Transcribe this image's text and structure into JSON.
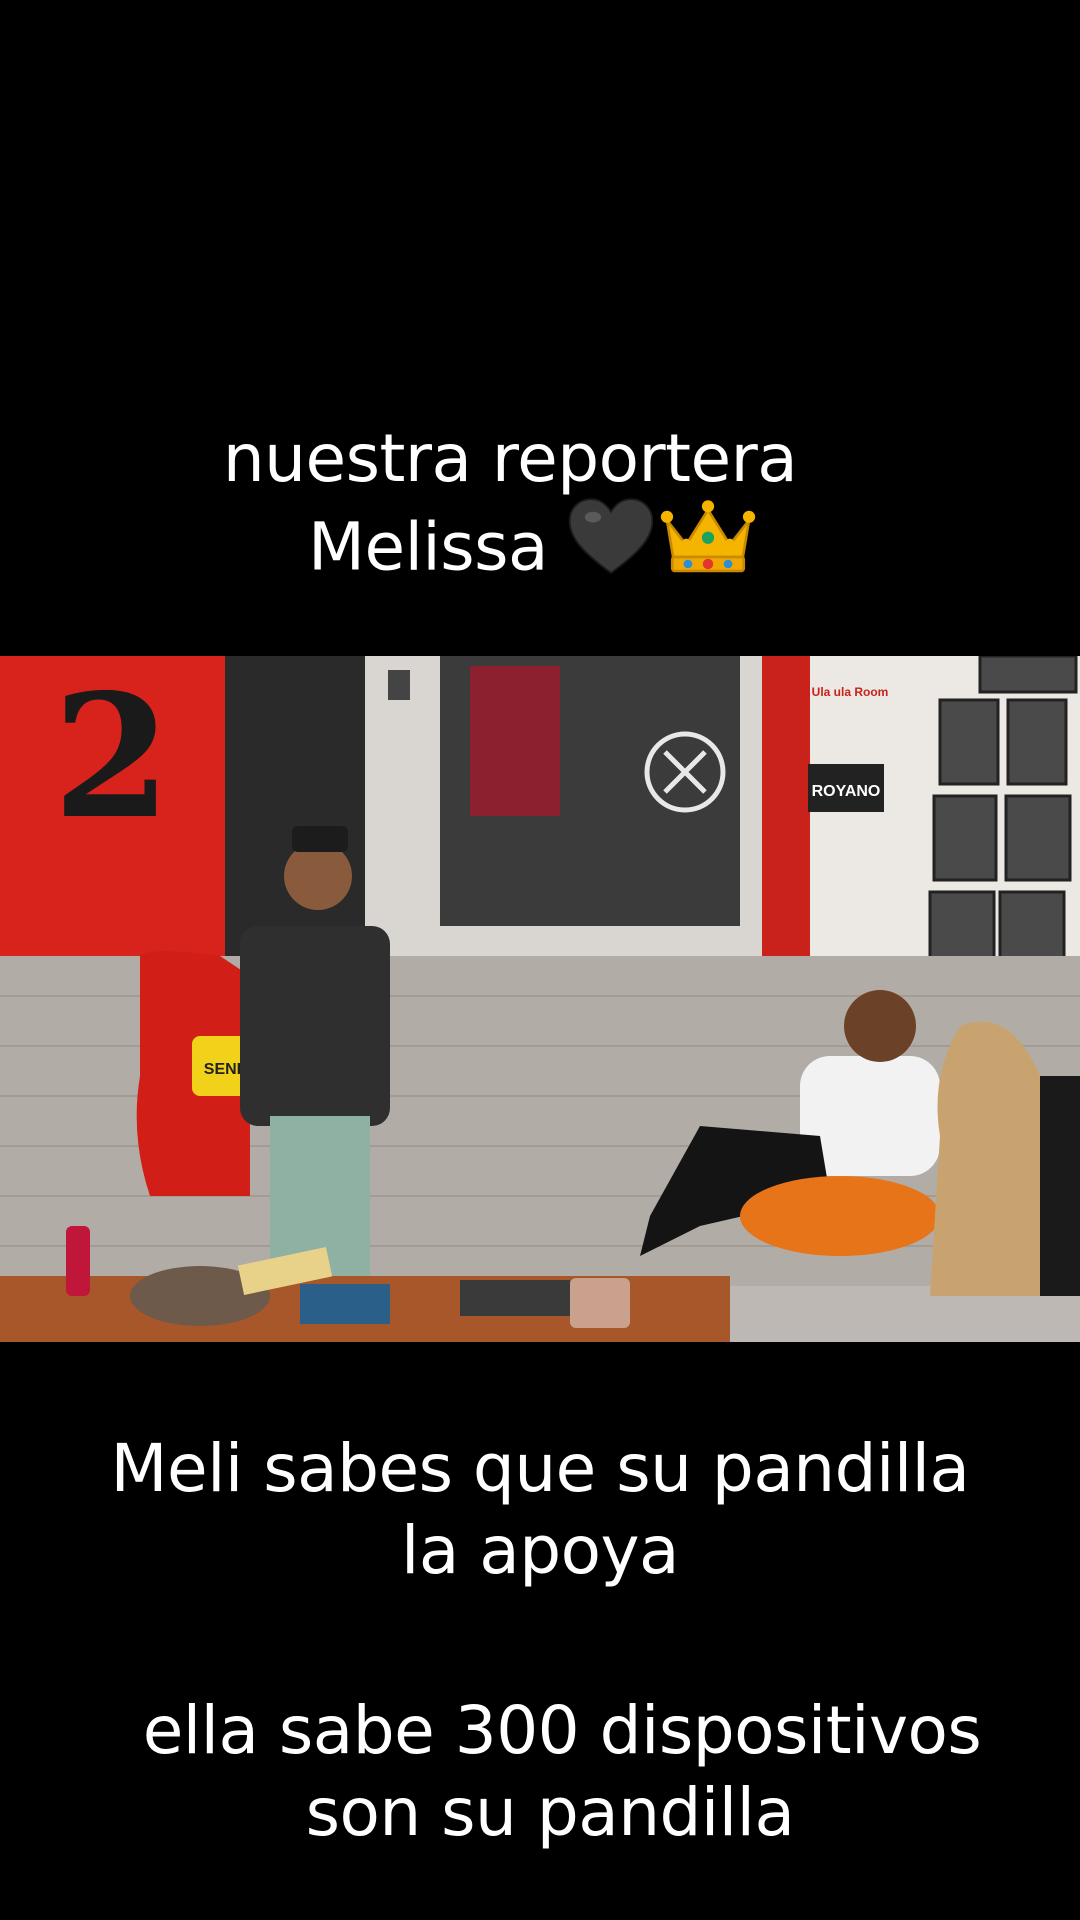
{
  "captions": {
    "top_line1": "nuestra reportera",
    "top_line2": "Melissa",
    "mid_line1": "Meli sabes que su pandilla",
    "mid_line2": "la apoya",
    "bot_line1": "ella sabe 300 dispositivos",
    "bot_line2": "son su pandilla"
  },
  "emojis": {
    "heart": "black-heart-icon",
    "crown": "crown-icon"
  },
  "video_scene": {
    "big_number": "2",
    "pillow_text": "SEND",
    "sign_line1": "Ula ula Room",
    "sign_line2": "ROYANO"
  },
  "colors": {
    "background": "#000000",
    "text": "#ffffff",
    "studio_red": "#d8231c",
    "crown_gold": "#f4b400"
  }
}
